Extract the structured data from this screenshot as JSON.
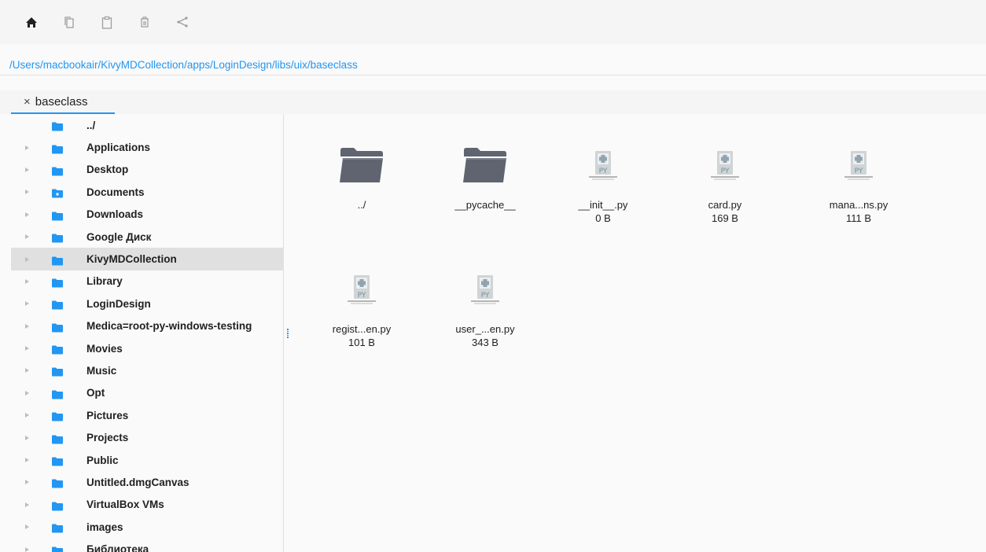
{
  "toolbar": {
    "icons": [
      "home-icon",
      "copy-icon",
      "paste-icon",
      "delete-icon",
      "share-icon"
    ]
  },
  "path": "/Users/macbookair/KivyMDCollection/apps/LoginDesign/libs/uix/baseclass",
  "tab": {
    "close": "×",
    "label": "baseclass"
  },
  "tree": {
    "items": [
      {
        "label": "../",
        "arrow": false
      },
      {
        "label": "Applications",
        "arrow": true
      },
      {
        "label": "Desktop",
        "arrow": true
      },
      {
        "label": "Documents",
        "arrow": true
      },
      {
        "label": "Downloads",
        "arrow": true
      },
      {
        "label": "Google Диск",
        "arrow": true
      },
      {
        "label": "KivyMDCollection",
        "arrow": true,
        "selected": true
      },
      {
        "label": "Library",
        "arrow": true
      },
      {
        "label": "LoginDesign",
        "arrow": true
      },
      {
        "label": "Medica=root-py-windows-testing",
        "arrow": true
      },
      {
        "label": "Movies",
        "arrow": true
      },
      {
        "label": "Music",
        "arrow": true
      },
      {
        "label": "Opt",
        "arrow": true
      },
      {
        "label": "Pictures",
        "arrow": true
      },
      {
        "label": "Projects",
        "arrow": true
      },
      {
        "label": "Public",
        "arrow": true
      },
      {
        "label": "Untitled.dmgCanvas",
        "arrow": true
      },
      {
        "label": "VirtualBox VMs",
        "arrow": true
      },
      {
        "label": "images",
        "arrow": true
      },
      {
        "label": "Библиотека",
        "arrow": true
      }
    ]
  },
  "files": [
    {
      "name": "../",
      "size": "",
      "kind": "folder"
    },
    {
      "name": "__pycache__",
      "size": "",
      "kind": "folder"
    },
    {
      "name": "__init__.py",
      "size": "0 B",
      "kind": "py"
    },
    {
      "name": "card.py",
      "size": "169 B",
      "kind": "py"
    },
    {
      "name": "mana...ns.py",
      "size": "111 B",
      "kind": "py"
    },
    {
      "name": "regist...en.py",
      "size": "101 B",
      "kind": "py"
    },
    {
      "name": "user_...en.py",
      "size": "343 B",
      "kind": "py"
    }
  ],
  "colors": {
    "accent": "#2196f3",
    "folder_blue": "#2196f3",
    "large_folder": "#5f6470",
    "selected_row": "#e0e0e0"
  }
}
